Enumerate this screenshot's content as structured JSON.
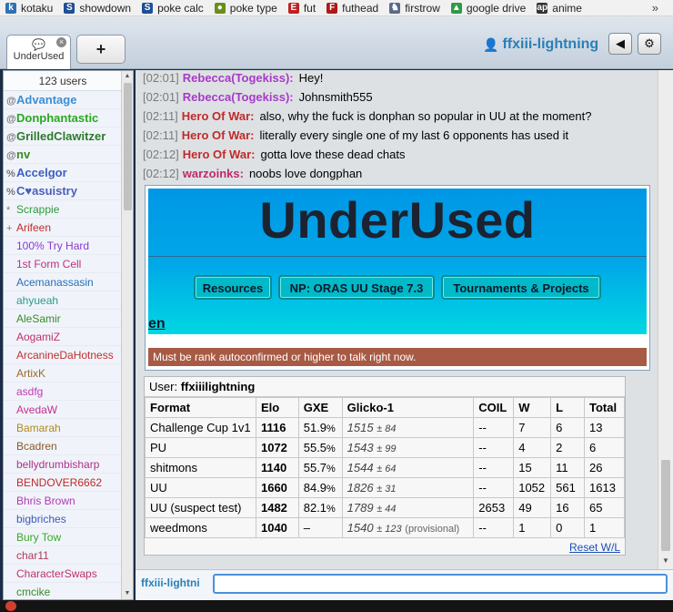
{
  "bookmarks": [
    {
      "label": "kotaku",
      "icon": "kotaku-icon",
      "color": "#2f6fb3",
      "glyph": "k"
    },
    {
      "label": "showdown",
      "icon": "showdown-icon",
      "color": "#1f4f96",
      "glyph": "S"
    },
    {
      "label": "poke calc",
      "icon": "poke-calc-icon",
      "color": "#1f4f96",
      "glyph": "S"
    },
    {
      "label": "poke type",
      "icon": "poke-type-icon",
      "color": "#6a8f1a",
      "glyph": "●"
    },
    {
      "label": "fut",
      "icon": "fut-icon",
      "color": "#c02020",
      "glyph": "E"
    },
    {
      "label": "futhead",
      "icon": "futhead-icon",
      "color": "#b01818",
      "glyph": "F"
    },
    {
      "label": "firstrow",
      "icon": "firstrow-icon",
      "color": "#5a6a88",
      "glyph": "♞"
    },
    {
      "label": "google drive",
      "icon": "google-drive-icon",
      "color": "#2d9a4a",
      "glyph": "▲"
    },
    {
      "label": "anime",
      "icon": "anime-icon",
      "color": "#333333",
      "glyph": "ap"
    }
  ],
  "bookmarks_more": "»",
  "header": {
    "tab_label": "UnderUsed",
    "add_tab_label": "+",
    "username": "ffxiii-lightning",
    "sound_icon": "speaker-icon",
    "settings_icon": "gear-icon"
  },
  "userlist": {
    "count": "123 users",
    "users": [
      {
        "rank": "@",
        "name": "Advantage",
        "color": "#3a8fd6",
        "bold": true
      },
      {
        "rank": "@",
        "name": "Donphantastic",
        "color": "#2aa81f",
        "bold": true
      },
      {
        "rank": "@",
        "name": "GrilledClawitzer",
        "color": "#2c7a2c",
        "bold": true
      },
      {
        "rank": "@",
        "name": "nv",
        "color": "#3a8a1f",
        "bold": true
      },
      {
        "rank": "%",
        "name": "Accelgor",
        "color": "#3a5fc0",
        "bold": true
      },
      {
        "rank": "%",
        "name": "C♥asuistry",
        "color": "#4b5fb8",
        "bold": true
      },
      {
        "rank": "*",
        "name": "Scrappie",
        "color": "#2f9a3a",
        "bold": false
      },
      {
        "rank": "+",
        "name": "Arifeen",
        "color": "#c02a2a",
        "bold": false
      },
      {
        "rank": " ",
        "name": "100% Try Hard",
        "color": "#8a3ad0",
        "bold": false
      },
      {
        "rank": " ",
        "name": "1st Form Cell",
        "color": "#c0307a",
        "bold": false
      },
      {
        "rank": " ",
        "name": "Acemanassasin",
        "color": "#2a6fb8",
        "bold": false
      },
      {
        "rank": " ",
        "name": "ahyueah",
        "color": "#2a9a8a",
        "bold": false
      },
      {
        "rank": " ",
        "name": "AleSamir",
        "color": "#3a8a2a",
        "bold": false
      },
      {
        "rank": " ",
        "name": "AogamiZ",
        "color": "#c0306a",
        "bold": false
      },
      {
        "rank": " ",
        "name": "ArcanineDaHotness",
        "color": "#c03030",
        "bold": false
      },
      {
        "rank": " ",
        "name": "ArtixK",
        "color": "#9a6a2a",
        "bold": false
      },
      {
        "rank": " ",
        "name": "asdfg",
        "color": "#c03ab0",
        "bold": false
      },
      {
        "rank": " ",
        "name": "AvedaW",
        "color": "#c0308a",
        "bold": false
      },
      {
        "rank": " ",
        "name": "Bamarah",
        "color": "#b08a1a",
        "bold": false
      },
      {
        "rank": " ",
        "name": "Bcadren",
        "color": "#8a5a2a",
        "bold": false
      },
      {
        "rank": " ",
        "name": "bellydrumbisharp",
        "color": "#b0308a",
        "bold": false
      },
      {
        "rank": " ",
        "name": "BENDOVER6662",
        "color": "#c02a2a",
        "bold": false
      },
      {
        "rank": " ",
        "name": "Bhris Brown",
        "color": "#b03ab0",
        "bold": false
      },
      {
        "rank": " ",
        "name": "bigbriches",
        "color": "#3a5ab8",
        "bold": false
      },
      {
        "rank": " ",
        "name": "Bury Tow",
        "color": "#3aa82a",
        "bold": false
      },
      {
        "rank": " ",
        "name": "char11",
        "color": "#b03a5a",
        "bold": false
      },
      {
        "rank": " ",
        "name": "CharacterSwaps",
        "color": "#c0306a",
        "bold": false
      },
      {
        "rank": " ",
        "name": "cmcike",
        "color": "#3a8a2a",
        "bold": false
      }
    ]
  },
  "chat": [
    {
      "time": "[02:01]",
      "author": "Rebecca(Togekiss):",
      "color": "#a63ac8",
      "text": "Hey!"
    },
    {
      "time": "[02:01]",
      "author": "Rebecca(Togekiss):",
      "color": "#a63ac8",
      "text": "Johnsmith555"
    },
    {
      "time": "[02:11]",
      "author": "Hero Of War:",
      "color": "#c02a2a",
      "text": "also, why the fuck is donphan so popular in UU at the moment?"
    },
    {
      "time": "[02:11]",
      "author": "Hero Of War:",
      "color": "#c02a2a",
      "text": "literally every single one of my last 6 opponents has used it"
    },
    {
      "time": "[02:12]",
      "author": "Hero Of War:",
      "color": "#c02a2a",
      "text": "gotta love these dead chats"
    },
    {
      "time": "[02:12]",
      "author": "warzoinks:",
      "color": "#c02a6a",
      "text": "noobs love dongphan"
    }
  ],
  "banner": {
    "title": "UnderUsed",
    "buttons": [
      "Resources",
      "NP: ORAS UU Stage 7.3",
      "Tournaments & Projects"
    ],
    "lang_link": "en",
    "warning": "Must be rank autoconfirmed or higher to talk right now."
  },
  "ranks": {
    "user_label": "User:",
    "user_name": "ffxiiilightning",
    "headers": [
      "Format",
      "Elo",
      "GXE",
      "Glicko-1",
      "COIL",
      "W",
      "L",
      "Total"
    ],
    "rows": [
      {
        "format": "Challenge Cup 1v1",
        "elo": "1116",
        "gxe": "51.9",
        "gxe_unit": "%",
        "glicko": "1515",
        "glicko_pm": "± 84",
        "prov": "",
        "coil": "--",
        "w": "7",
        "l": "6",
        "total": "13"
      },
      {
        "format": "PU",
        "elo": "1072",
        "gxe": "55.5",
        "gxe_unit": "%",
        "glicko": "1543",
        "glicko_pm": "± 99",
        "prov": "",
        "coil": "--",
        "w": "4",
        "l": "2",
        "total": "6"
      },
      {
        "format": "shitmons",
        "elo": "1140",
        "gxe": "55.7",
        "gxe_unit": "%",
        "glicko": "1544",
        "glicko_pm": "± 64",
        "prov": "",
        "coil": "--",
        "w": "15",
        "l": "11",
        "total": "26"
      },
      {
        "format": "UU",
        "elo": "1660",
        "gxe": "84.9",
        "gxe_unit": "%",
        "glicko": "1826",
        "glicko_pm": "± 31",
        "prov": "",
        "coil": "--",
        "w": "1052",
        "l": "561",
        "total": "1613"
      },
      {
        "format": "UU (suspect test)",
        "elo": "1482",
        "gxe": "82.1",
        "gxe_unit": "%",
        "glicko": "1789",
        "glicko_pm": "± 44",
        "prov": "",
        "coil": "2653",
        "w": "49",
        "l": "16",
        "total": "65"
      },
      {
        "format": "weedmons",
        "elo": "1040",
        "gxe": "–",
        "gxe_unit": "",
        "glicko": "1540",
        "glicko_pm": "± 123",
        "prov": "(provisional)",
        "coil": "--",
        "w": "1",
        "l": "0",
        "total": "1"
      }
    ],
    "reset_link": "Reset W/L"
  },
  "compose": {
    "name": "ffxiii-lightni",
    "value": ""
  }
}
